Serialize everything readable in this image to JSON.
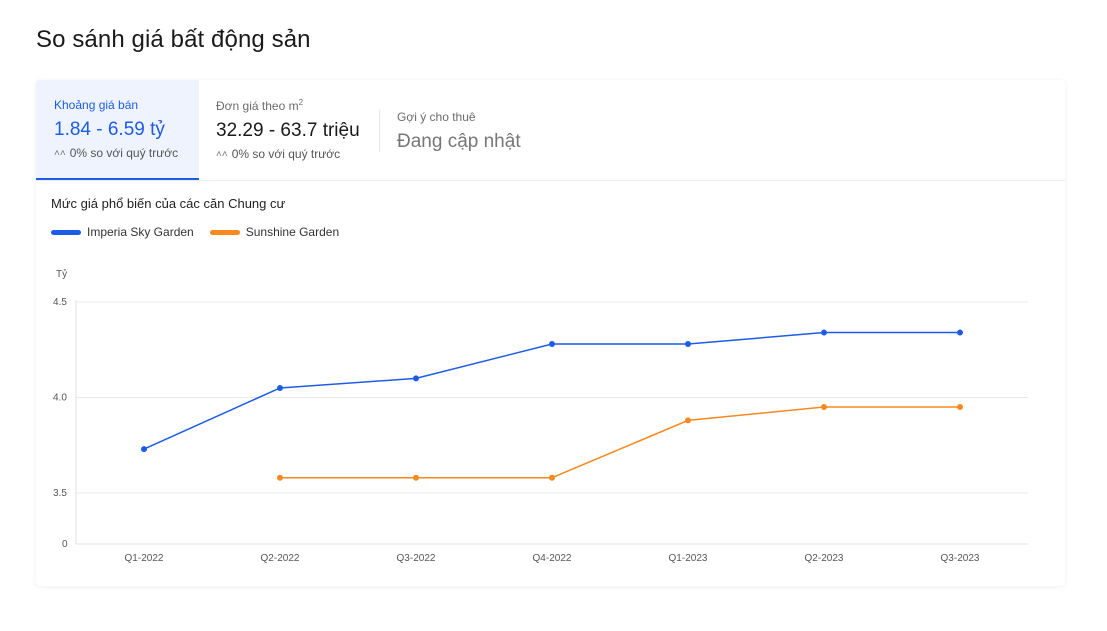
{
  "page": {
    "title": "So sánh giá bất động sản"
  },
  "tabs": [
    {
      "label": "Khoảng giá bán",
      "value": "1.84 - 6.59 tỷ",
      "change": "0% so với quý trước",
      "active": true
    },
    {
      "label": "Đơn giá theo m",
      "label_sup": "2",
      "value": "32.29 - 63.7 triệu",
      "change": "0% so với quý trước",
      "active": false
    },
    {
      "label": "Gợi ý cho thuê",
      "value": "Đang cập nhật",
      "active": false
    }
  ],
  "icons": {
    "change_icon": "double-chevron-up-icon"
  },
  "chart_data": {
    "type": "line",
    "title": "Mức giá phổ biến của các căn Chung cư",
    "ylabel": "Tỷ",
    "x": [
      "Q1-2022",
      "Q2-2022",
      "Q3-2022",
      "Q4-2022",
      "Q1-2023",
      "Q2-2023",
      "Q3-2023"
    ],
    "y_ticks": [
      "0",
      "3.5",
      "4.0",
      "4.5"
    ],
    "grid": true,
    "legend": "top-left",
    "series": [
      {
        "name": "Imperia Sky Garden",
        "color": "#1d5ce6",
        "values": [
          3.73,
          4.05,
          4.1,
          4.28,
          4.28,
          4.34,
          4.34
        ]
      },
      {
        "name": "Sunshine Garden",
        "color": "#f7891f",
        "values": [
          null,
          3.58,
          3.58,
          3.58,
          3.88,
          3.95,
          3.95
        ]
      }
    ]
  }
}
